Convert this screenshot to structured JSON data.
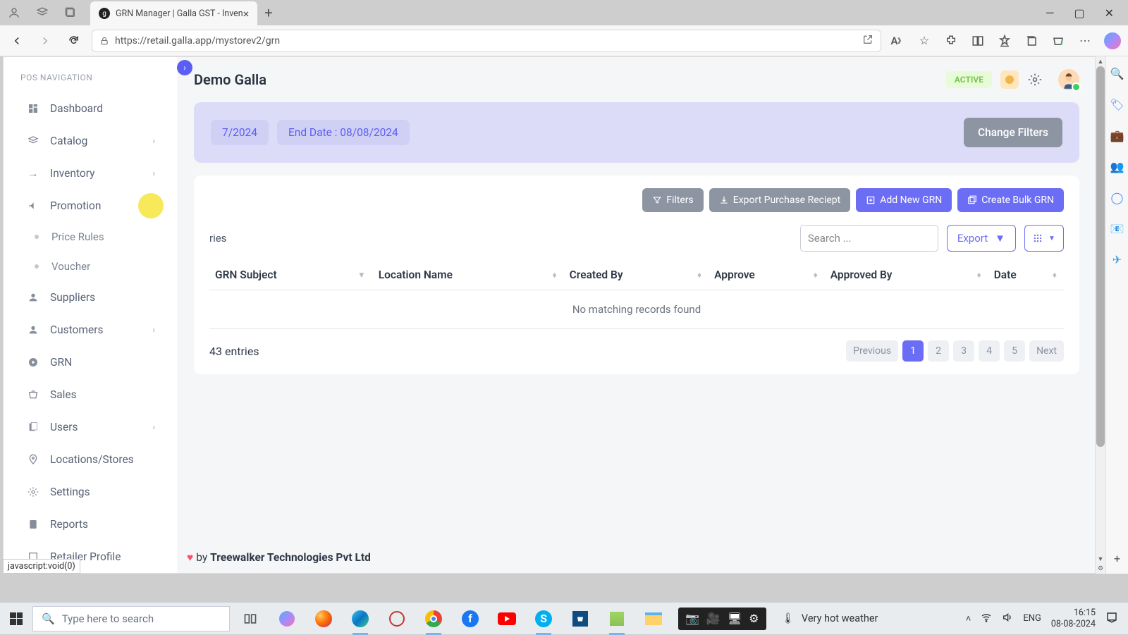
{
  "browser": {
    "tab_title": "GRN Manager | Galla GST - Inven",
    "url": "https://retail.galla.app/mystorev2/grn",
    "status_hover": "javascript:void(0)"
  },
  "sidebar": {
    "section": "POS NAVIGATION",
    "items": {
      "dashboard": "Dashboard",
      "catalog": "Catalog",
      "inventory": "Inventory",
      "promotion": "Promotion",
      "price_rules": "Price Rules",
      "voucher": "Voucher",
      "suppliers": "Suppliers",
      "customers": "Customers",
      "grn": "GRN",
      "sales": "Sales",
      "users": "Users",
      "locations": "Locations/Stores",
      "settings": "Settings",
      "reports": "Reports",
      "retailer": "Retailer Profile"
    }
  },
  "header": {
    "brand": "Demo Galla",
    "status": "ACTIVE"
  },
  "filters": {
    "start_chip": "7/2024",
    "end_chip": "End Date : 08/08/2024",
    "change_btn": "Change Filters"
  },
  "toolbar": {
    "filters": "Filters",
    "export_pr": "Export Purchase Reciept",
    "add_new": "Add New GRN",
    "bulk": "Create Bulk GRN"
  },
  "table": {
    "entries_suffix": "ries",
    "search_placeholder": "Search ...",
    "export": "Export",
    "cols": {
      "subject": "GRN Subject",
      "location": "Location Name",
      "created": "Created By",
      "approve": "Approve",
      "approved_by": "Approved By",
      "date": "Date"
    },
    "empty": "No matching records found",
    "total_suffix": "43 entries",
    "pager": {
      "prev": "Previous",
      "p1": "1",
      "p2": "2",
      "p3": "3",
      "p4": "4",
      "p5": "5",
      "next": "Next"
    }
  },
  "footer": {
    "by": "by",
    "company": "Treewalker Technologies Pvt Ltd"
  },
  "taskbar": {
    "search_placeholder": "Type here to search",
    "weather": "Very hot weather",
    "lang": "ENG",
    "time": "16:15",
    "date": "08-08-2024"
  }
}
